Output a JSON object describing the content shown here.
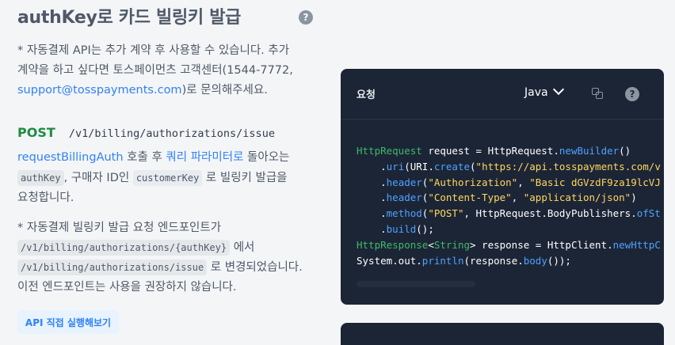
{
  "section": {
    "title": "authKey로 카드 빌링키 발급",
    "note_line1": "* 자동결제 API는 추가 계약 후 사용할 수 있습니다. 추가",
    "note_line2": "계약을 하고 싶다면 토스페이먼츠 고객센터(1544-7772,",
    "note_email": "support@tosspayments.com",
    "note_tail": ")로 문의해주세요."
  },
  "endpoint": {
    "method": "POST",
    "path": "/v1/billing/authorizations/issue"
  },
  "description": {
    "link_text": "requestBillingAuth",
    "after_link": " 호출 후 ",
    "query_link": "쿼리 파라미터로",
    "after_query": " 돌아오는",
    "chip_authkey": "authKey",
    "mid_text": ", 구매자 ID인",
    "chip_customerkey": "customerKey",
    "after_chip": "로 빌링키 발급을",
    "last_line": "요청합니다."
  },
  "notice": {
    "line1": "* 자동결제 빌링키 발급 요청 엔드포인트가",
    "chip_old": "/v1/billing/authorizations/{authKey}",
    "after_old": "에서",
    "chip_new": "/v1/billing/authorizations/issue",
    "after_new": "로 변경되었습니다.",
    "line4": "이전 엔드포인트는 사용을 권장하지 않습니다."
  },
  "run_button": "API 직접 실행해보기",
  "request_panel": {
    "title": "요청",
    "language": "Java",
    "icons": [
      "copy-icon",
      "help-icon"
    ],
    "help_glyph": "?",
    "code_tokens": {
      "l1_type": "HttpRequest",
      "l1_var": " request = HttpRequest.",
      "l1_fn": "newBuilder",
      "l1_end": "()",
      "l2_indent": "    .",
      "l2_fn": "uri",
      "l2_mid": "(URI.",
      "l2_fn2": "create",
      "l2_open": "(",
      "l2_str": "\"https://api.tosspayments.com/v",
      "l3_indent": "    .",
      "l3_fn": "header",
      "l3_open": "(",
      "l3_str1": "\"Authorization\"",
      "l3_sep": ", ",
      "l3_str2": "\"Basic dGVzdF9za19lcVJ",
      "l4_indent": "    .",
      "l4_fn": "header",
      "l4_open": "(",
      "l4_str1": "\"Content-Type\"",
      "l4_sep": ", ",
      "l4_str2": "\"application/json\"",
      "l4_end": ")",
      "l5_indent": "    .",
      "l5_fn": "method",
      "l5_open": "(",
      "l5_str": "\"POST\"",
      "l5_mid": ", HttpRequest.BodyPublishers.",
      "l5_fn2": "ofSt",
      "l6_indent": "    .",
      "l6_fn": "build",
      "l6_end": "();",
      "l7_type": "HttpResponse",
      "l7_lt": "<",
      "l7_type2": "String",
      "l7_gt": ">",
      "l7_mid": " response = HttpClient.",
      "l7_fn": "newHttpC",
      "l8_a": "System.out.",
      "l8_fn": "println",
      "l8_b": "(response.",
      "l8_fn2": "body",
      "l8_c": "());"
    }
  },
  "title_help_glyph": "?"
}
